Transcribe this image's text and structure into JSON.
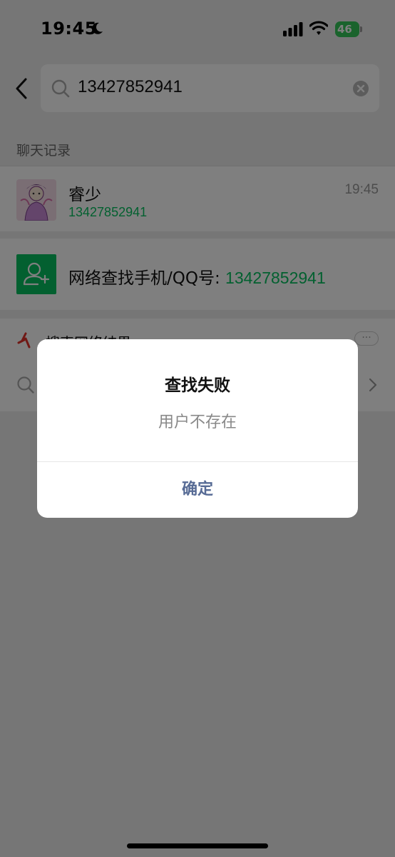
{
  "status_bar": {
    "time": "19:45",
    "battery_level": "46",
    "icons": [
      "moon-icon",
      "cellular-signal-icon",
      "wifi-icon",
      "battery-charging-icon"
    ]
  },
  "search": {
    "value": "13427852941"
  },
  "results": {
    "section_label": "聊天记录",
    "chat": {
      "name": "睿少",
      "time": "19:45",
      "snippet": "13427852941"
    },
    "lookup": {
      "label": "网络查找手机/QQ号: ",
      "number": "13427852941"
    },
    "web": {
      "label": "搜索网络结果",
      "more": "···"
    }
  },
  "dialog": {
    "title": "查找失败",
    "message": "用户不存在",
    "confirm_label": "确定"
  },
  "colors": {
    "accent_green": "#07c160",
    "dialog_button": "#576b95",
    "overlay": "rgba(0,0,0,0.5)",
    "page_bg": "#ededed"
  }
}
